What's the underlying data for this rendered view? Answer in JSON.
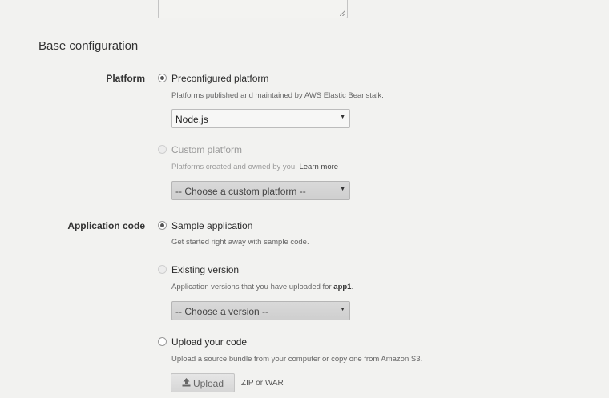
{
  "base_config": {
    "title": "Base configuration"
  },
  "platform": {
    "label": "Platform",
    "preconfigured": {
      "label": "Preconfigured platform",
      "help": "Platforms published and maintained by AWS Elastic Beanstalk.",
      "selected": "Node.js"
    },
    "custom": {
      "label": "Custom platform",
      "help": "Platforms created and owned by you.",
      "learn_more": "Learn more",
      "select_placeholder": "-- Choose a custom platform --"
    }
  },
  "application_code": {
    "label": "Application code",
    "sample": {
      "label": "Sample application",
      "help": "Get started right away with sample code."
    },
    "existing": {
      "label": "Existing version",
      "help_prefix": "Application versions that you have uploaded for",
      "app_name": "app1",
      "help_suffix": ".",
      "select_placeholder": "-- Choose a version --"
    },
    "upload": {
      "label": "Upload your code",
      "help": "Upload a source bundle from your computer or copy one from Amazon S3.",
      "button_label": "Upload",
      "hint": "ZIP or WAR"
    }
  },
  "icons": {
    "dropdown": "caret-down",
    "upload": "upload-arrow"
  }
}
